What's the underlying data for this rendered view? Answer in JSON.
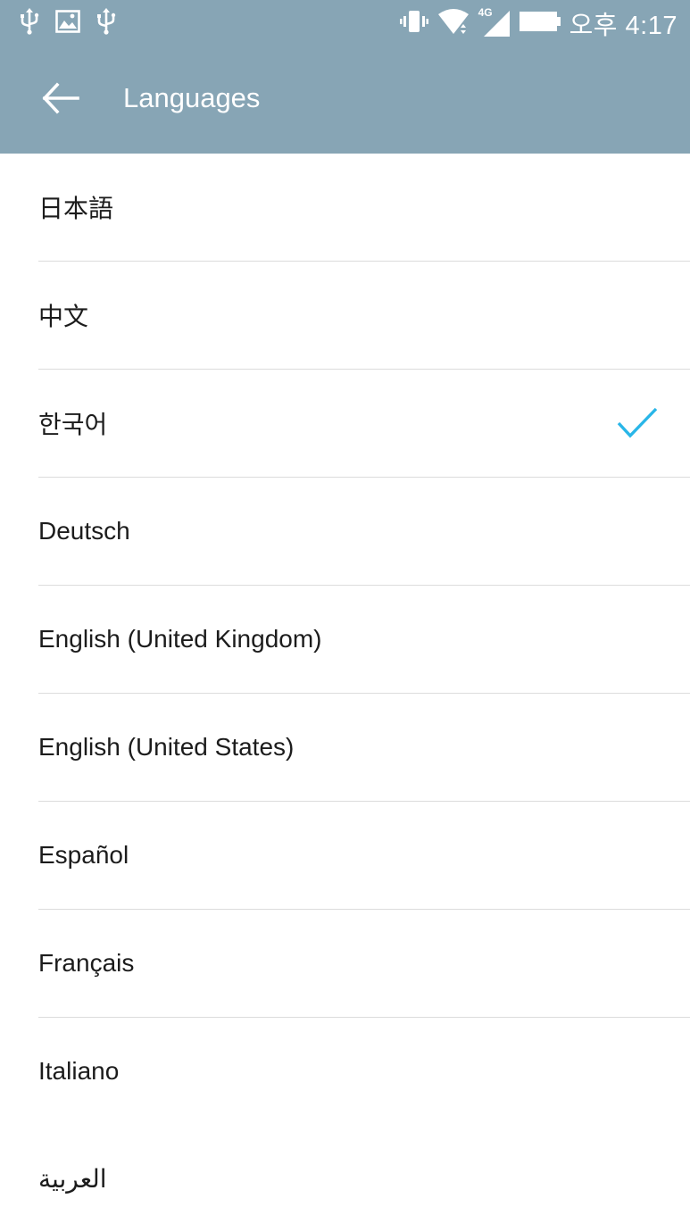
{
  "status_bar": {
    "left_icons": [
      "usb-icon",
      "image-icon",
      "usb-icon"
    ],
    "right_icons": [
      "vibrate-icon",
      "wifi-icon",
      "signal-4g-icon",
      "battery-icon"
    ],
    "network_label": "4G",
    "time": "오후 4:17"
  },
  "toolbar": {
    "title": "Languages",
    "back_icon": "arrow-back-icon"
  },
  "colors": {
    "appbar": "#87a5b5",
    "check": "#29b6e8",
    "divider": "#dcdcdc"
  },
  "languages": [
    {
      "label": "日本語",
      "selected": false
    },
    {
      "label": "中文",
      "selected": false
    },
    {
      "label": "한국어",
      "selected": true
    },
    {
      "label": "Deutsch",
      "selected": false
    },
    {
      "label": "English (United Kingdom)",
      "selected": false
    },
    {
      "label": "English (United States)",
      "selected": false
    },
    {
      "label": "Español",
      "selected": false
    },
    {
      "label": "Français",
      "selected": false
    },
    {
      "label": "Italiano",
      "selected": false
    },
    {
      "label": "العربية",
      "selected": false
    }
  ]
}
